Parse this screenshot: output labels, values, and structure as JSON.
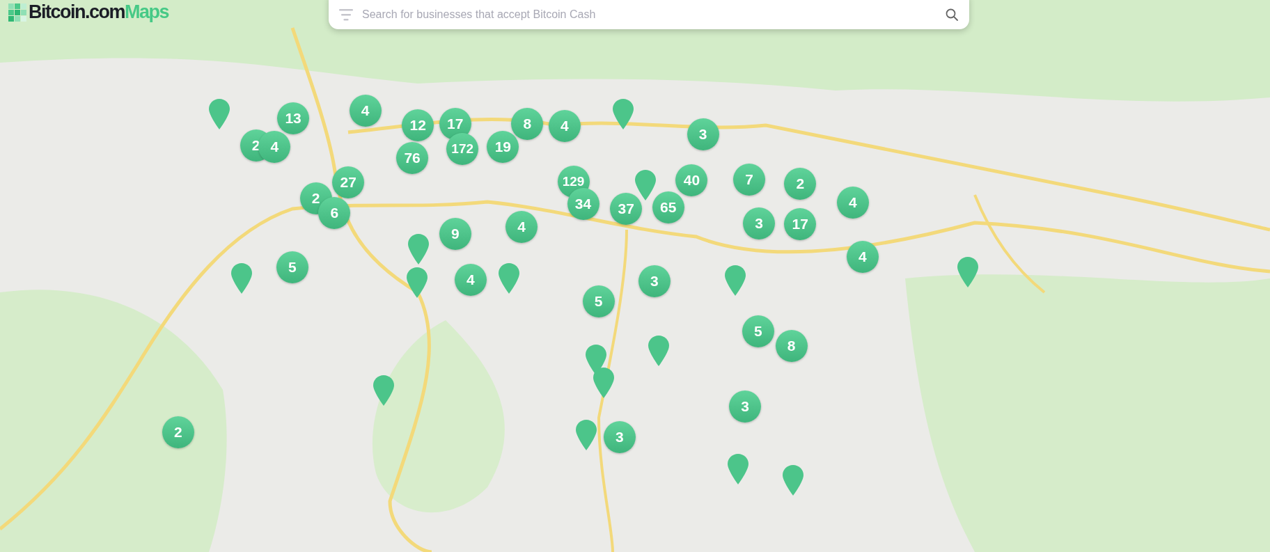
{
  "logo": {
    "brand": "Bitcoin.com",
    "product": "Maps"
  },
  "search": {
    "placeholder": "Search for businesses that accept Bitcoin Cash"
  },
  "clusters": [
    "13",
    "2",
    "4",
    "4",
    "12",
    "17",
    "76",
    "172",
    "19",
    "8",
    "4",
    "3",
    "27",
    "2",
    "6",
    "9",
    "4",
    "129",
    "34",
    "37",
    "65",
    "40",
    "7",
    "2",
    "4",
    "3",
    "17",
    "4",
    "5",
    "4",
    "3",
    "5",
    "5",
    "8",
    "3",
    "3",
    "2"
  ],
  "pins": [
    {
      "kind": "pin"
    },
    {
      "kind": "pin"
    },
    {
      "kind": "pin"
    },
    {
      "kind": "pin"
    },
    {
      "kind": "pin"
    },
    {
      "kind": "pin"
    },
    {
      "kind": "pin"
    },
    {
      "kind": "pin"
    },
    {
      "kind": "pin"
    },
    {
      "kind": "pin"
    },
    {
      "kind": "pin"
    },
    {
      "kind": "pin"
    },
    {
      "kind": "pin"
    },
    {
      "kind": "pin"
    },
    {
      "kind": "pin"
    },
    {
      "kind": "pin"
    }
  ]
}
